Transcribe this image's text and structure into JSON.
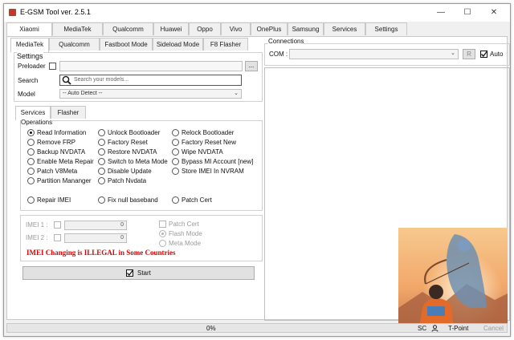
{
  "window": {
    "title": "E-GSM Tool ver. 2.5.1",
    "minimize": "—",
    "maximize": "☐",
    "close": "✕"
  },
  "top_tabs": [
    "Xiaomi",
    "MediaTek",
    "Qualcomm",
    "Huawei",
    "Oppo",
    "Vivo",
    "OnePlus",
    "Samsung",
    "Services",
    "Settings"
  ],
  "sub_tabs": [
    "MediaTek",
    "Qualcomm",
    "Fastboot Mode",
    "Sideload Mode",
    "F8 Flasher"
  ],
  "settings": {
    "title": "Settings",
    "preloader_label": "Preloader",
    "browse": "...",
    "search_label": "Search",
    "search_placeholder": "Search your models...",
    "model_label": "Model",
    "model_value": "-- Auto Detect --"
  },
  "service_tabs": [
    "Services",
    "Flasher"
  ],
  "operations": {
    "title": "Operations",
    "col1": [
      "Read Information",
      "Remove FRP",
      "Backup NVDATA",
      "Enable Meta Repair",
      "Patch V8Meta",
      "Partition Mananger"
    ],
    "col2": [
      "Unlock Bootloader",
      "Factory Reset",
      "Restore NVDATA",
      "Switch to Meta Mode",
      "Disable Update",
      "Patch Nvdata"
    ],
    "col3": [
      "Relock Bootloader",
      "Factory Reset New",
      "Wipe NVDATA",
      "Bypass MI Account [new]",
      "Store IMEI In NVRAM"
    ],
    "extra": [
      "Repair IMEI",
      "Fix null baseband",
      "Patch Cert"
    ]
  },
  "imei": {
    "imei1_label": "IMEI 1 :",
    "imei2_label": "IMEI 2 :",
    "imei1_count": "0",
    "imei2_count": "0",
    "patch_cert": "Patch Cert",
    "flash_mode": "Flash Mode",
    "meta_mode": "Meta Mode",
    "warning": "IMEI Changing is ILLEGAL in Some Countries"
  },
  "start_label": "Start",
  "connections": {
    "title": "Connections",
    "com_label": "COM :",
    "refresh": "R",
    "auto_label": "Auto",
    "auto_checked": true
  },
  "status": {
    "progress": "0%",
    "progress_value": 0,
    "sc": "SC",
    "user_icon": "user-icon",
    "tpoint": "T-Point",
    "cancel": "Cancel"
  },
  "colors": {
    "warning": "#e00000",
    "accent": "#c0392b"
  }
}
